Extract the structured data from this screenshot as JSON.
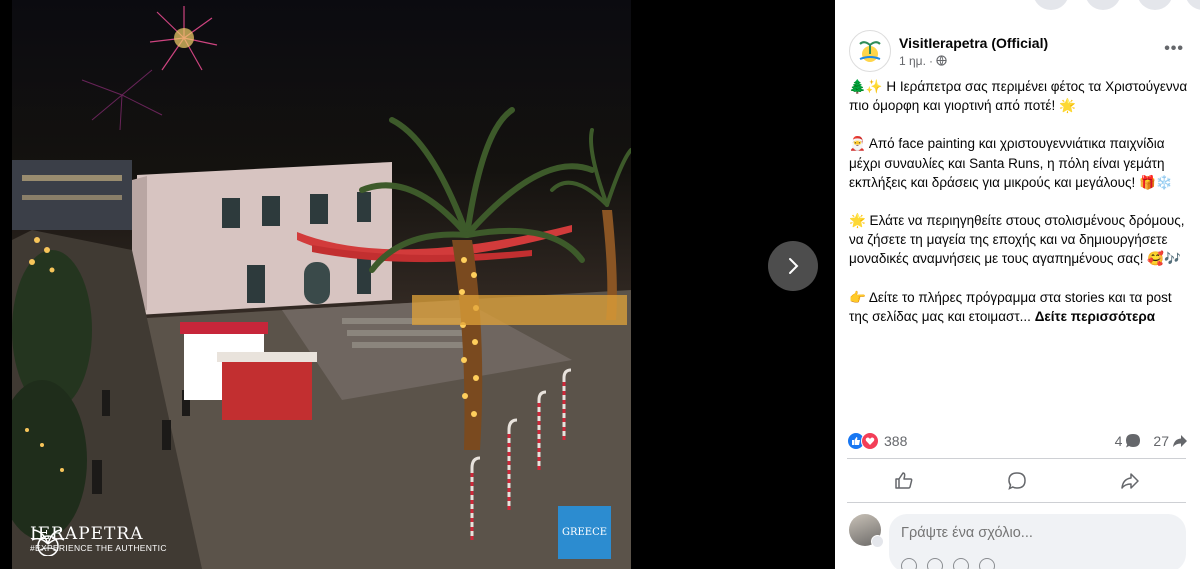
{
  "media": {
    "brand_title": "IERAPETRA",
    "brand_tagline": "#EXPERIENCE THE AUTHENTIC",
    "badge_text": "GREECE",
    "next_icon": "chevron-right-icon"
  },
  "post": {
    "page_name": "VisitIerapetra (Official)",
    "time": "1 ημ.",
    "privacy_icon": "globe-icon",
    "paragraphs": [
      "🌲✨ Η Ιεράπετρα σας περιμένει φέτος τα Χριστούγεννα πιο όμορφη και γιορτινή από ποτέ! 🌟",
      "🎅 Από face painting και χριστουγεννιάτικα παιχνίδια μέχρι συναυλίες και Santa Runs, η πόλη είναι γεμάτη εκπλήξεις και δράσεις για μικρούς και μεγάλους! 🎁❄️",
      "🌟 Ελάτε να περιηγηθείτε στους στολισμένους δρόμους, να ζήσετε τη μαγεία της εποχής και να δημιουργήσετε μοναδικές αναμνήσεις με τους αγαπημένους σας! 🥰🎶",
      "👉 Δείτε το πλήρες πρόγραμμα στα stories και τα post της σελίδας μας και ετοιμαστ..."
    ],
    "see_more": "Δείτε περισσότερα"
  },
  "stats": {
    "reactions": "388",
    "comments": "4",
    "shares": "27"
  },
  "actions": {
    "like_icon": "thumbs-up-icon",
    "comment_icon": "speech-bubble-icon",
    "share_icon": "share-arrow-icon"
  },
  "comment": {
    "placeholder": "Γράψτε ένα σχόλιο..."
  },
  "colors": {
    "like_blue": "#1877f2",
    "love_red": "#f33e58",
    "badge_blue": "#2c8cd0"
  }
}
